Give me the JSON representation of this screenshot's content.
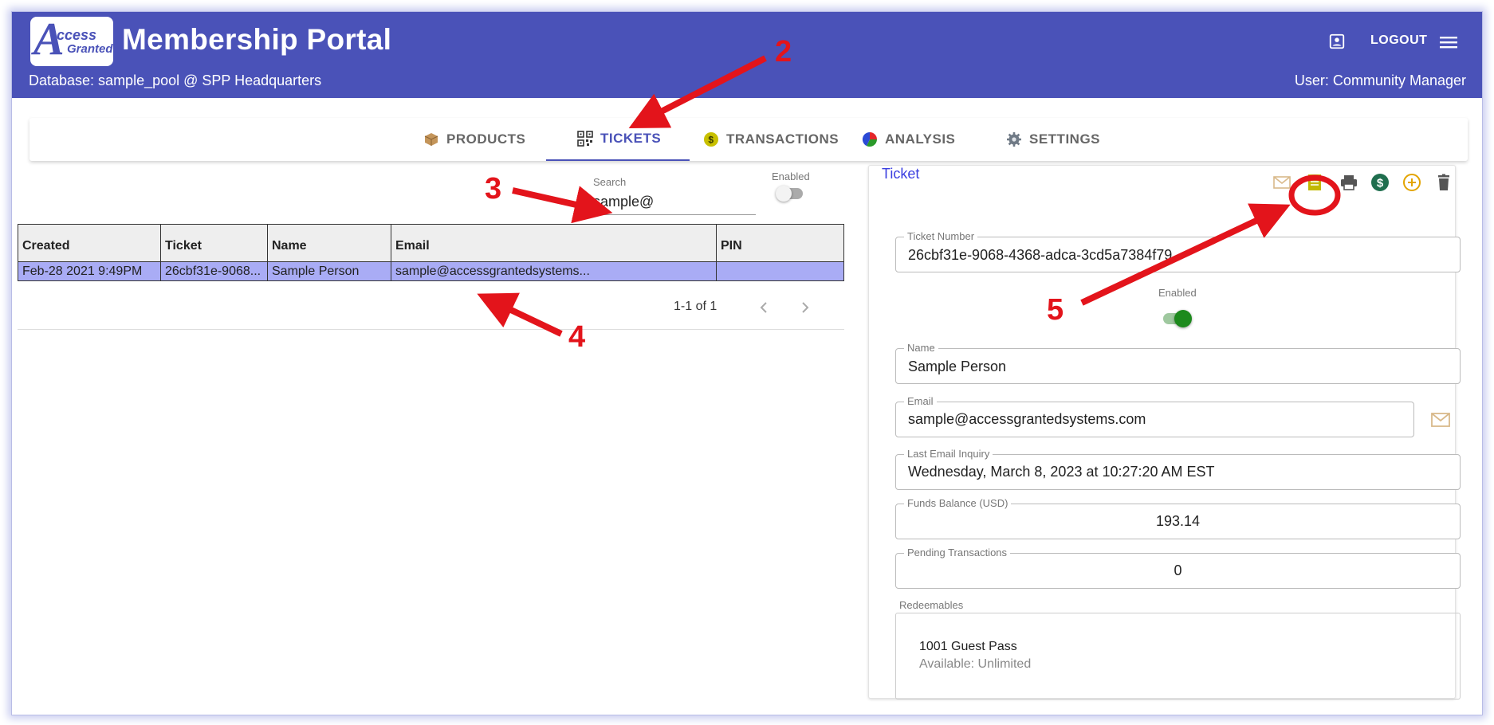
{
  "header": {
    "app_title": "Membership Portal",
    "logo": {
      "letter": "A",
      "line1": "ccess",
      "line2": "Granted"
    },
    "database_line": "Database: sample_pool @ SPP Headquarters",
    "user_line": "User: Community Manager",
    "logout_label": "LOGOUT",
    "icons": [
      "account-box-icon",
      "menu-icon"
    ],
    "color": "#4a52b8"
  },
  "tabs": [
    {
      "label": "PRODUCTS",
      "icon": "package-icon",
      "active": false
    },
    {
      "label": "TICKETS",
      "icon": "qr-code-icon",
      "active": true
    },
    {
      "label": "TRANSACTIONS",
      "icon": "dollar-coin-icon",
      "active": false
    },
    {
      "label": "ANALYSIS",
      "icon": "pie-chart-icon",
      "active": false
    },
    {
      "label": "SETTINGS",
      "icon": "gear-icon",
      "active": false
    }
  ],
  "search": {
    "label": "Search",
    "value": "sample@"
  },
  "filter_enabled": {
    "label": "Enabled",
    "on": false
  },
  "table": {
    "columns": [
      "Created",
      "Ticket",
      "Name",
      "Email",
      "PIN"
    ],
    "rows": [
      {
        "created": "Feb-28 2021 9:49PM",
        "ticket": "26cbf31e-9068...",
        "name": "Sample Person",
        "email": "sample@accessgrantedsystems...",
        "pin": ""
      }
    ],
    "pagination": "1-1 of 1"
  },
  "ticket_panel": {
    "title": "Ticket",
    "toolbar_icons": [
      "email-icon",
      "receipt-icon",
      "print-icon",
      "dollar-icon",
      "add-circle-icon",
      "delete-icon"
    ],
    "ticket_number": {
      "label": "Ticket Number",
      "value": "26cbf31e-9068-4368-adca-3cd5a7384f79"
    },
    "enabled": {
      "label": "Enabled",
      "on": true
    },
    "name": {
      "label": "Name",
      "value": "Sample Person"
    },
    "email": {
      "label": "Email",
      "value": "sample@accessgrantedsystems.com"
    },
    "last_email_inquiry": {
      "label": "Last Email Inquiry",
      "value": "Wednesday, March 8, 2023 at 10:27:20 AM EST"
    },
    "funds_balance": {
      "label": "Funds Balance (USD)",
      "value": "193.14"
    },
    "pending_transactions": {
      "label": "Pending Transactions",
      "value": "0"
    },
    "redeemables": {
      "label": "Redeemables",
      "items": [
        {
          "name": "1001 Guest Pass",
          "availability": "Available: Unlimited"
        }
      ]
    }
  },
  "annotations": {
    "numbers": [
      "2",
      "3",
      "4",
      "5"
    ],
    "color": "#e3141b"
  }
}
